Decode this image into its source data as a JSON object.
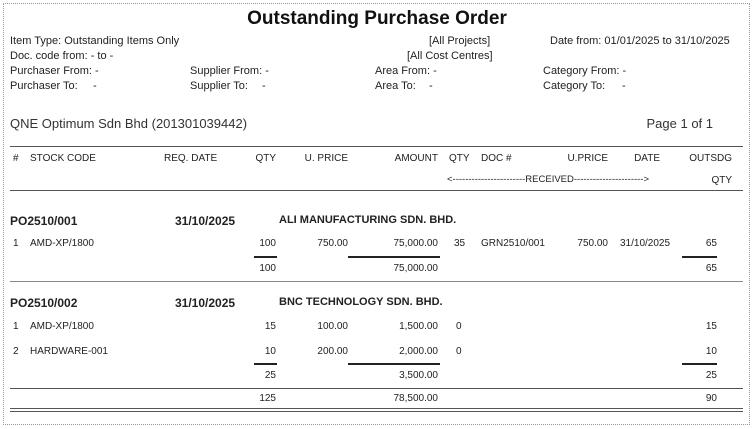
{
  "report": {
    "title": "Outstanding Purchase Order",
    "item_type": "Item Type: Outstanding Items Only",
    "doc_code": "Doc. code from: - to -",
    "purchaser_from": "Purchaser From: -",
    "purchaser_to_label": "Purchaser To:",
    "purchaser_to_value": "-",
    "supplier_from": "Supplier From: -",
    "supplier_to_label": "Supplier To:",
    "supplier_to_value": "-",
    "projects": "[All Projects]",
    "cost_centres": "[All Cost Centres]",
    "area_from": "Area From: -",
    "area_to_label": "Area To:",
    "area_to_value": "-",
    "date_range": "Date from: 01/01/2025 to 31/10/2025",
    "category_from": "Category From: -",
    "category_to_label": "Category To:",
    "category_to_value": "-",
    "company": "QNE Optimum Sdn Bhd (201301039442)",
    "page": "Page 1 of 1"
  },
  "columns": {
    "num": "#",
    "stock_code": "STOCK CODE",
    "req_date": "REQ. DATE",
    "qty": "QTY",
    "u_price": "U. PRICE",
    "amount": "AMOUNT",
    "rqty": "QTY",
    "doc": "DOC #",
    "r_uprice": "U.PRICE",
    "date": "DATE",
    "outsdg": "OUTSDG",
    "received": "<-----------------------RECEIVED---------------------->",
    "outsdg_qty": "QTY"
  },
  "orders": [
    {
      "po": "PO2510/001",
      "date": "31/10/2025",
      "supplier": "ALI MANUFACTURING SDN. BHD.",
      "lines": [
        {
          "num": "1",
          "code": "AMD-XP/1800",
          "qty": "100",
          "price": "750.00",
          "amount": "75,000.00",
          "rqty": "35",
          "doc": "GRN2510/001",
          "rprice": "750.00",
          "rdate": "31/10/2025",
          "out": "65"
        }
      ],
      "subtotal": {
        "qty": "100",
        "amount": "75,000.00",
        "out": "65"
      }
    },
    {
      "po": "PO2510/002",
      "date": "31/10/2025",
      "supplier": "BNC TECHNOLOGY SDN. BHD.",
      "lines": [
        {
          "num": "1",
          "code": "AMD-XP/1800",
          "qty": "15",
          "price": "100.00",
          "amount": "1,500.00",
          "rqty": "0",
          "out": "15"
        },
        {
          "num": "2",
          "code": "HARDWARE-001",
          "qty": "10",
          "price": "200.00",
          "amount": "2,000.00",
          "rqty": "0",
          "out": "10"
        }
      ],
      "subtotal": {
        "qty": "25",
        "amount": "3,500.00",
        "out": "25"
      }
    }
  ],
  "grand_total": {
    "qty": "125",
    "amount": "78,500.00",
    "out": "90"
  }
}
